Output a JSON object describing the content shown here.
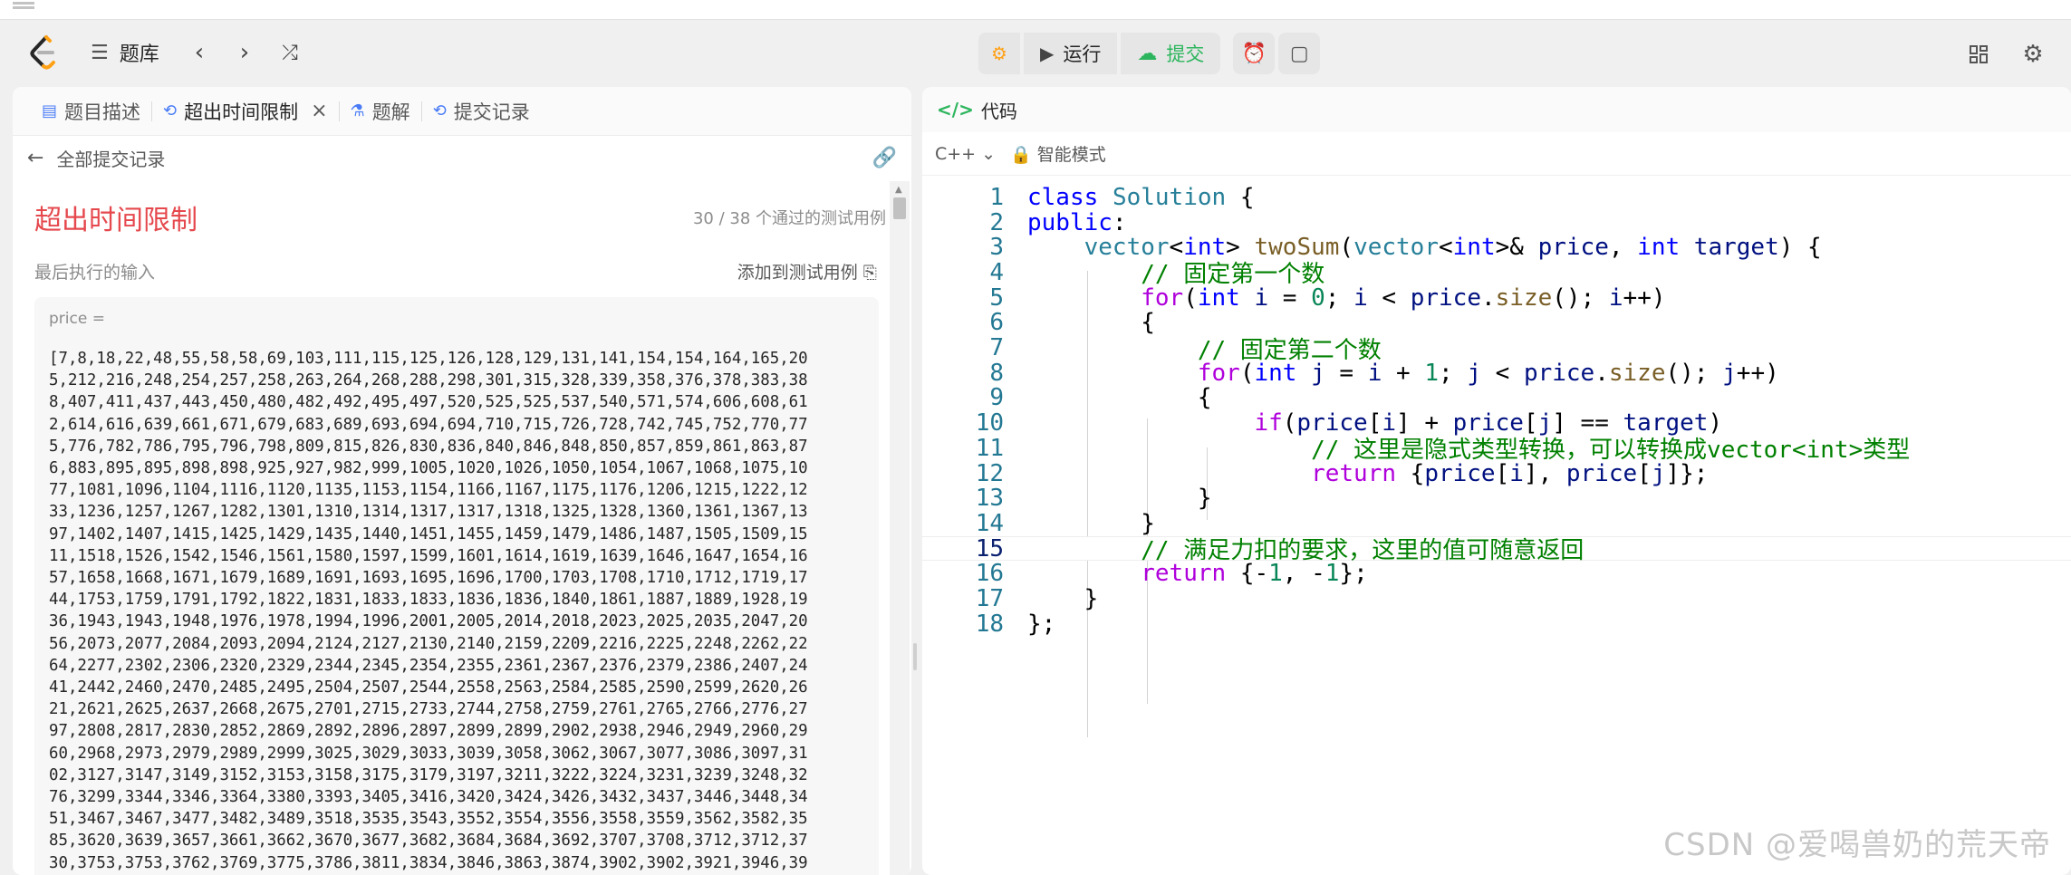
{
  "nav": {
    "problem_list": "题库",
    "run": "运行",
    "submit": "提交"
  },
  "left": {
    "tabs": [
      {
        "label": "题目描述"
      },
      {
        "label": "超出时间限制"
      },
      {
        "label": "题解"
      },
      {
        "label": "提交记录"
      }
    ],
    "back_label": "全部提交记录",
    "result": "超出时间限制",
    "passed": "30 / 38  个通过的测试用例",
    "last_input_label": "最后执行的输入",
    "add_testcase": "添加到测试用例",
    "input_var": "price =",
    "price_lines": [
      "[7,8,18,22,48,55,58,58,69,103,111,115,125,126,128,129,131,141,154,154,164,165,20",
      "5,212,216,248,254,257,258,263,264,268,288,298,301,315,328,339,358,376,378,383,38",
      "8,407,411,437,443,450,480,482,492,495,497,520,525,525,537,540,571,574,606,608,61",
      "2,614,616,639,661,671,679,683,689,693,694,694,710,715,726,728,742,745,752,770,77",
      "5,776,782,786,795,796,798,809,815,826,830,836,840,846,848,850,857,859,861,863,87",
      "6,883,895,895,898,898,925,927,982,999,1005,1020,1026,1050,1054,1067,1068,1075,10",
      "77,1081,1096,1104,1116,1120,1135,1153,1154,1166,1167,1175,1176,1206,1215,1222,12",
      "33,1236,1257,1267,1282,1301,1310,1314,1317,1317,1318,1325,1328,1360,1361,1367,13",
      "97,1402,1407,1415,1425,1429,1435,1440,1451,1455,1459,1479,1486,1487,1505,1509,15",
      "11,1518,1526,1542,1546,1561,1580,1597,1599,1601,1614,1619,1639,1646,1647,1654,16",
      "57,1658,1668,1671,1679,1689,1691,1693,1695,1696,1700,1703,1708,1710,1712,1719,17",
      "44,1753,1759,1791,1792,1822,1831,1833,1833,1836,1836,1840,1861,1887,1889,1928,19",
      "36,1943,1943,1948,1976,1978,1994,1996,2001,2005,2014,2018,2023,2025,2035,2047,20",
      "56,2073,2077,2084,2093,2094,2124,2127,2130,2140,2159,2209,2216,2225,2248,2262,22",
      "64,2277,2302,2306,2320,2329,2344,2345,2354,2355,2361,2367,2376,2379,2386,2407,24",
      "41,2442,2460,2470,2485,2495,2504,2507,2544,2558,2563,2584,2585,2590,2599,2620,26",
      "21,2621,2625,2637,2668,2675,2701,2715,2733,2744,2758,2759,2761,2765,2766,2776,27",
      "97,2808,2817,2830,2852,2869,2892,2896,2897,2899,2899,2902,2938,2946,2949,2960,29",
      "60,2968,2973,2979,2989,2999,3025,3029,3033,3039,3058,3062,3067,3077,3086,3097,31",
      "02,3127,3147,3149,3152,3153,3158,3175,3179,3197,3211,3222,3224,3231,3239,3248,32",
      "76,3299,3344,3346,3364,3380,3393,3405,3416,3420,3424,3426,3432,3437,3446,3448,34",
      "51,3467,3467,3477,3482,3489,3518,3535,3543,3552,3554,3556,3558,3559,3562,3582,35",
      "85,3620,3639,3657,3661,3662,3670,3677,3682,3684,3684,3692,3707,3708,3712,3712,37",
      "30,3753,3753,3762,3769,3775,3786,3811,3834,3846,3863,3874,3902,3902,3921,3946,39"
    ]
  },
  "right": {
    "code_tab": "代码",
    "lang": "C++",
    "mode": "智能模式",
    "code": [
      {
        "no": "1",
        "t": "class Solution {"
      },
      {
        "no": "2",
        "t": "public:"
      },
      {
        "no": "3",
        "t": "    vector<int> twoSum(vector<int>& price, int target) {"
      },
      {
        "no": "4",
        "t": "        // 固定第一个数"
      },
      {
        "no": "5",
        "t": "        for(int i = 0; i < price.size(); i++)"
      },
      {
        "no": "6",
        "t": "        {"
      },
      {
        "no": "7",
        "t": "            // 固定第二个数"
      },
      {
        "no": "8",
        "t": "            for(int j = i + 1; j < price.size(); j++)"
      },
      {
        "no": "9",
        "t": "            {"
      },
      {
        "no": "10",
        "t": "                if(price[i] + price[j] == target)"
      },
      {
        "no": "11",
        "t": "                    // 这里是隐式类型转换，可以转换成vector<int>类型"
      },
      {
        "no": "12",
        "t": "                    return {price[i], price[j]};"
      },
      {
        "no": "13",
        "t": "            }"
      },
      {
        "no": "14",
        "t": "        }"
      },
      {
        "no": "15",
        "t": "        // 满足力扣的要求，这里的值可随意返回"
      },
      {
        "no": "16",
        "t": "        return {-1, -1};"
      },
      {
        "no": "17",
        "t": "    }"
      },
      {
        "no": "18",
        "t": "};"
      }
    ]
  },
  "watermark": "CSDN @爱喝兽奶的荒天帝"
}
